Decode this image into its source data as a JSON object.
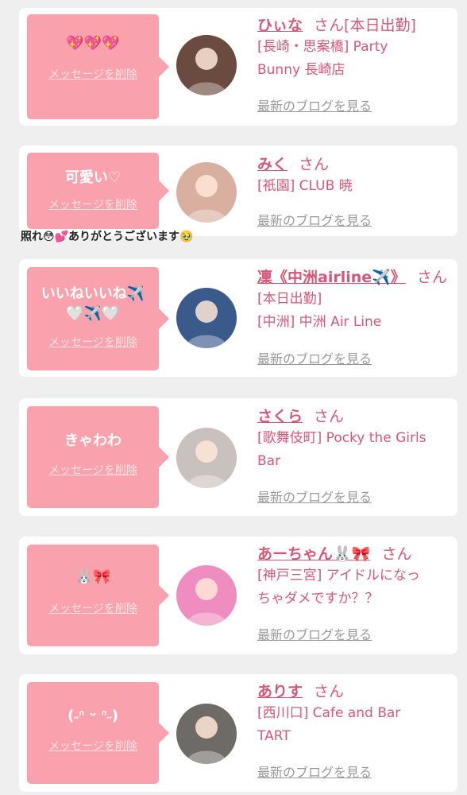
{
  "cards": [
    {
      "message": "💖💖💖",
      "delete_label": "メッセージを削除",
      "name": "ひぃな",
      "suffix": "さん",
      "extra": "[本日出勤]",
      "lines": [
        "[長崎・思案橋] Party",
        "Bunny 長崎店"
      ],
      "blog_label": "最新のブログを見る",
      "avatar_icon": "girl-avatar-icon",
      "avatar_color": "#6b4a3f"
    },
    {
      "message": "可愛い♡",
      "delete_label": "メッセージを削除",
      "name": "みく",
      "suffix": "さん",
      "extra": "",
      "lines": [
        "[祇園] CLUB 暁"
      ],
      "blog_label": "最新のブログを見る",
      "avatar_icon": "girl-avatar-icon",
      "avatar_color": "#d9b0a0"
    },
    {
      "message": "いいねいいね✈️\n🤍✈️🤍",
      "delete_label": "メッセージを削除",
      "name": "凜《中洲airline✈️》",
      "suffix": "さん",
      "extra": "",
      "lines": [
        "[本日出勤]",
        "[中洲] 中洲 Air Line"
      ],
      "blog_label": "最新のブログを見る",
      "avatar_icon": "airline-avatar-icon",
      "avatar_color": "#3a5a8c"
    },
    {
      "message": "きゃわわ",
      "delete_label": "メッセージを削除",
      "name": "さくら",
      "suffix": "さん",
      "extra": "",
      "lines": [
        "[歌舞伎町] Pocky the Girls",
        "Bar"
      ],
      "blog_label": "最新のブログを見る",
      "avatar_icon": "girl-avatar-icon",
      "avatar_color": "#c9c1bd"
    },
    {
      "message": "🐰🎀",
      "delete_label": "メッセージを削除",
      "name": "あーちゃん🐰🎀",
      "suffix": "さん",
      "extra": "",
      "lines": [
        "[神戸三宮] アイドルになっ",
        "ちゃダメですか？？"
      ],
      "blog_label": "最新のブログを見る",
      "avatar_icon": "girl-avatar-icon",
      "avatar_color": "#f08dc0"
    },
    {
      "message": "(˶ᐢ ᵕ ᐢ˶)",
      "delete_label": "メッセージを削除",
      "name": "ありす",
      "suffix": "さん",
      "extra": "",
      "lines": [
        "[西川口] Cafe and Bar",
        "TART"
      ],
      "blog_label": "最新のブログを見る",
      "avatar_icon": "girl-avatar-icon",
      "avatar_color": "#6e6a66"
    }
  ],
  "overlay_caption": "照れ😳💕ありがとうございます🥹",
  "colors": {
    "accent_pink": "#d6577a",
    "bubble_pink": "#f9a1ad",
    "page_bg": "#efefef",
    "card_bg": "#ffffff",
    "muted_gray": "#999999"
  }
}
